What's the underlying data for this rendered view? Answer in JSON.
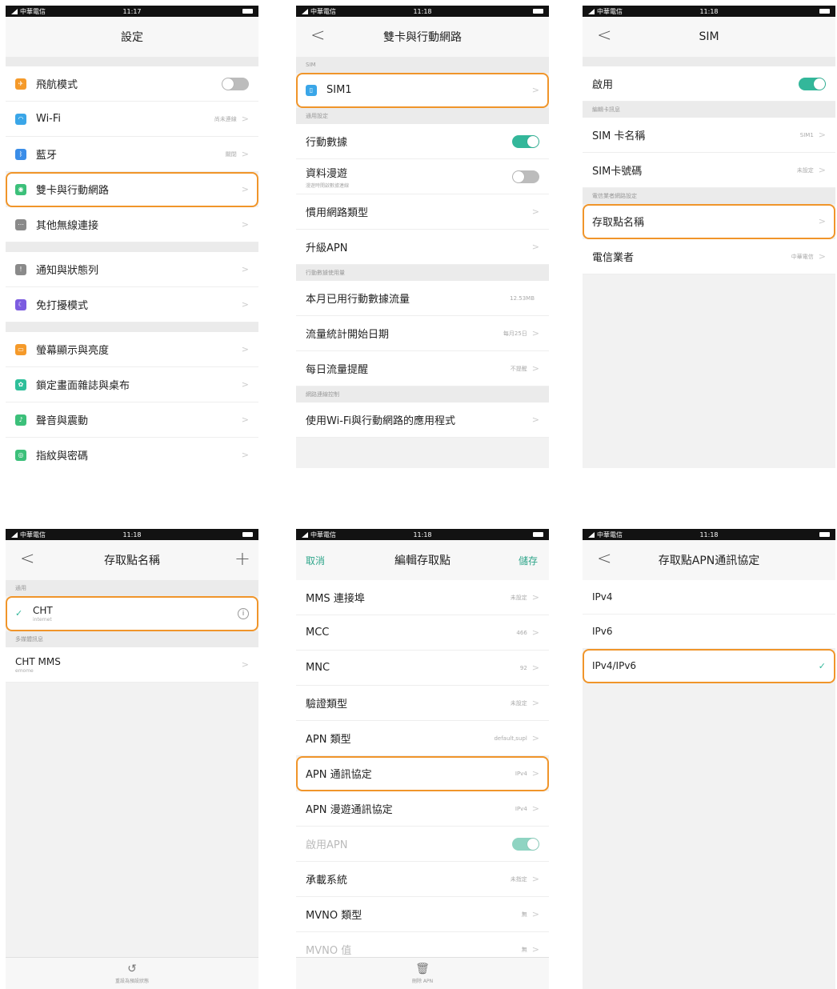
{
  "status": {
    "carrier": "中華電信",
    "time1": "11:17",
    "time": "11:18"
  },
  "colors": {
    "accent_green": "#33b79a",
    "highlight": "#f0952a"
  },
  "settings": {
    "title": "設定",
    "items": [
      {
        "label": "飛航模式",
        "value": "",
        "icon": "airplane-icon",
        "color": "#f59a2a"
      },
      {
        "label": "Wi-Fi",
        "value": "尚未連線",
        "icon": "wifi-icon",
        "color": "#3aa6e8"
      },
      {
        "label": "藍牙",
        "value": "關閉",
        "icon": "bluetooth-icon",
        "color": "#3a8de8"
      },
      {
        "label": "雙卡與行動網路",
        "value": "",
        "icon": "cellular-icon",
        "color": "#3cc07a"
      },
      {
        "label": "其他無線連接",
        "value": "",
        "icon": "wireless-icon",
        "color": "#8a8a8a"
      },
      {
        "label": "通知與狀態列",
        "value": "",
        "icon": "notification-icon",
        "color": "#8a8a8a"
      },
      {
        "label": "免打擾模式",
        "value": "",
        "icon": "moon-icon",
        "color": "#7c5ce0"
      },
      {
        "label": "螢幕顯示與亮度",
        "value": "",
        "icon": "display-icon",
        "color": "#f59a2a"
      },
      {
        "label": "鎖定畫面雜誌與桌布",
        "value": "",
        "icon": "wallpaper-icon",
        "color": "#2ebf9a"
      },
      {
        "label": "聲音與震動",
        "value": "",
        "icon": "sound-icon",
        "color": "#3cc07a"
      },
      {
        "label": "指紋與密碼",
        "value": "",
        "icon": "fingerprint-icon",
        "color": "#3cc07a"
      }
    ]
  },
  "dual": {
    "title": "雙卡與行動網路",
    "sec_sim": "SIM",
    "sim1": "SIM1",
    "sec_general": "通用設定",
    "mobile_data": "行動數據",
    "roaming": "資料漫遊",
    "roaming_sub": "漫遊時開啟數據連線",
    "pref_network": "慣用網路類型",
    "upgrade_apn": "升級APN",
    "sec_usage": "行動數據使用量",
    "used_month": "本月已用行動數據流量",
    "used_value": "12.53MB",
    "stat_start": "流量統計開始日期",
    "stat_value": "每月25日",
    "daily_alert": "每日流量提醒",
    "daily_value": "不提醒",
    "sec_control": "網路連線控制",
    "apps": "使用Wi-Fi與行動網路的應用程式"
  },
  "sim": {
    "title": "SIM",
    "enable": "啟用",
    "sec_edit": "編輯卡訊息",
    "sim_name": "SIM 卡名稱",
    "sim_name_value": "SIM1",
    "sim_number": "SIM卡號碼",
    "sim_number_value": "未設定",
    "sec_carrier": "電信業者網路設定",
    "apn": "存取點名稱",
    "carrier": "電信業者",
    "carrier_value": "中華電信"
  },
  "apn_list": {
    "title": "存取點名稱",
    "sec_general": "通用",
    "item1_name": "CHT",
    "item1_sub": "internet",
    "sec_mms": "多媒體訊息",
    "item2_name": "CHT MMS",
    "item2_sub": "emome",
    "reset": "重設為預設狀態"
  },
  "apn_edit": {
    "cancel": "取消",
    "title": "編輯存取點",
    "save": "儲存",
    "rows": [
      {
        "label": "MMS 連接埠",
        "value": "未設定"
      },
      {
        "label": "MCC",
        "value": "466"
      },
      {
        "label": "MNC",
        "value": "92"
      },
      {
        "label": "驗證類型",
        "value": "未設定"
      },
      {
        "label": "APN 類型",
        "value": "default,supl"
      },
      {
        "label": "APN 通訊協定",
        "value": "IPv4"
      },
      {
        "label": "APN 漫遊通訊協定",
        "value": "IPv4"
      }
    ],
    "enable_apn": "啟用APN",
    "bearer": "承載系統",
    "bearer_value": "未指定",
    "mvno_type": "MVNO 類型",
    "mvno_type_value": "無",
    "mvno_value": "MVNO 值",
    "mvno_value_value": "無",
    "delete": "刪除 APN"
  },
  "protocol": {
    "title": "存取點APN通訊協定",
    "options": [
      "IPv4",
      "IPv6",
      "IPv4/IPv6"
    ]
  }
}
